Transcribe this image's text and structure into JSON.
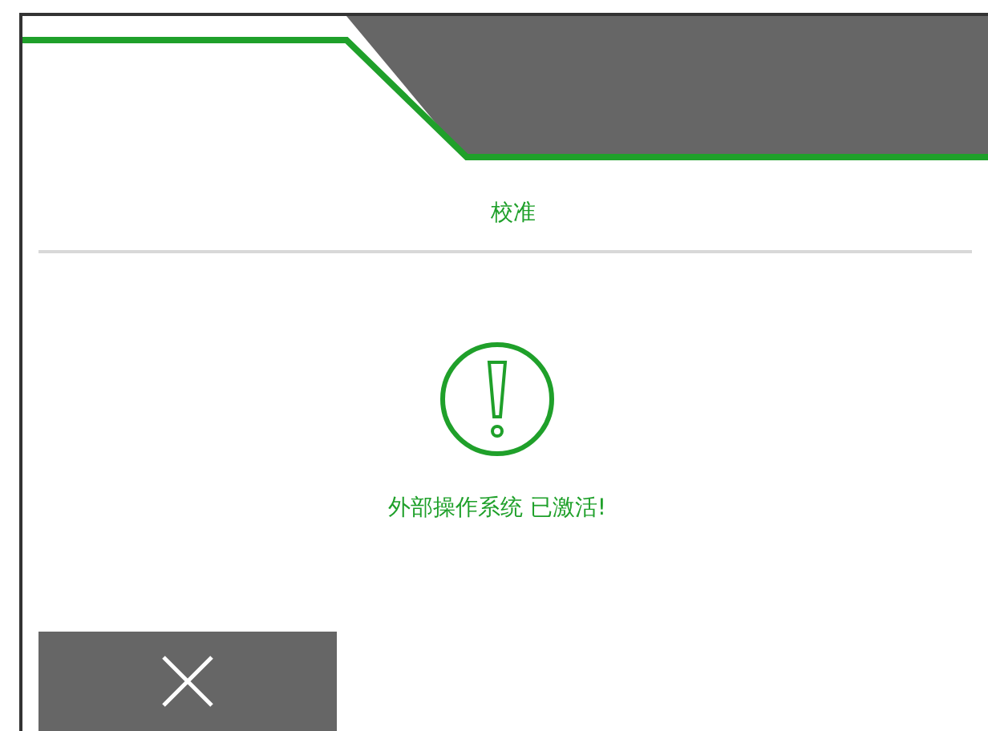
{
  "title": "校准",
  "message": "外部操作系统 已激活!"
}
